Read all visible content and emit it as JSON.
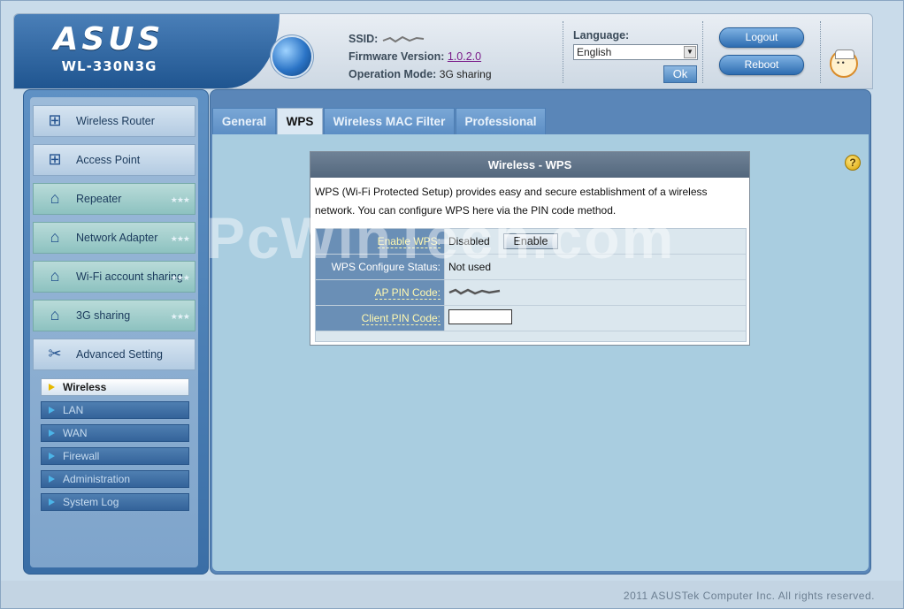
{
  "header": {
    "brand": "ASUS",
    "model": "WL-330N3G",
    "ssid_label": "SSID:",
    "firmware_label": "Firmware Version:",
    "firmware_value": "1.0.2.0",
    "mode_label": "Operation Mode:",
    "mode_value": "3G sharing",
    "language_label": "Language:",
    "language_value": "English",
    "ok_label": "Ok",
    "logout_label": "Logout",
    "reboot_label": "Reboot"
  },
  "sidebar": {
    "items": [
      {
        "label": "Wireless Router",
        "icon": "network-icon"
      },
      {
        "label": "Access Point",
        "icon": "network-icon"
      },
      {
        "label": "Repeater",
        "icon": "wifi-router-icon"
      },
      {
        "label": "Network Adapter",
        "icon": "wifi-router-icon"
      },
      {
        "label": "Wi-Fi account sharing",
        "icon": "wifi-router-icon"
      },
      {
        "label": "3G sharing",
        "icon": "wifi-router-icon"
      },
      {
        "label": "Advanced Setting",
        "icon": "tools-icon"
      }
    ],
    "sub_items": [
      "Wireless",
      "LAN",
      "WAN",
      "Firewall",
      "Administration",
      "System Log"
    ]
  },
  "tabs": [
    "General",
    "WPS",
    "Wireless MAC Filter",
    "Professional"
  ],
  "panel": {
    "title": "Wireless - WPS",
    "description": "WPS (Wi-Fi Protected Setup) provides easy and secure establishment of a wireless network. You can configure WPS here via the PIN code method.",
    "enable_wps_label": "Enable WPS:",
    "enable_wps_value": "Disabled",
    "enable_button": "Enable",
    "status_label": "WPS Configure Status:",
    "status_value": "Not used",
    "ap_pin_label": "AP PIN Code:",
    "client_pin_label": "Client PIN Code:",
    "client_pin_value": ""
  },
  "watermark": "PcWinTech.com",
  "footer": {
    "copyright": "2011 ASUSTek Computer Inc. All rights reserved."
  },
  "colors": {
    "header_blue": "#2f6aa8",
    "panel_title": "#5f7389",
    "label_bg": "#6a8fb6",
    "label_text": "#fff8b0"
  }
}
